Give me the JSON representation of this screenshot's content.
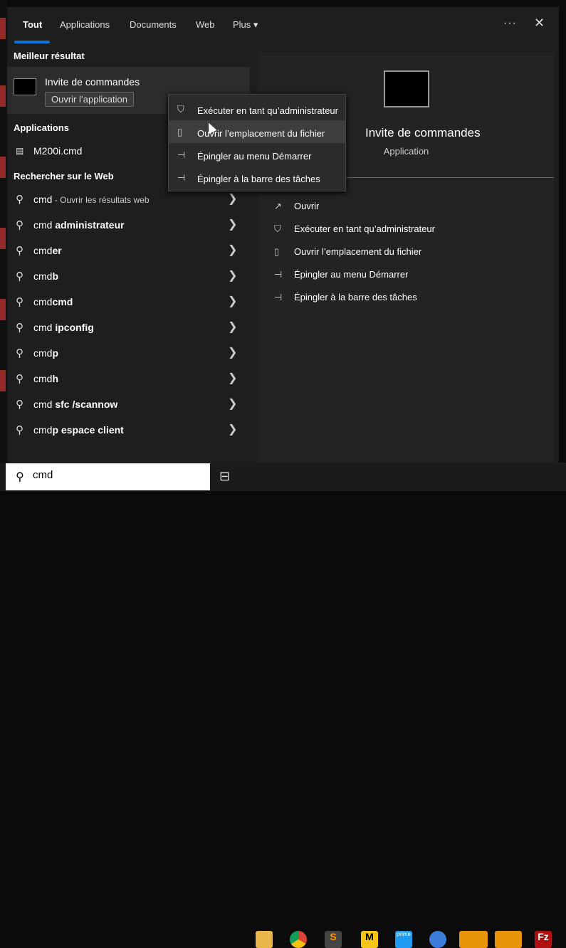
{
  "tabs": [
    {
      "label": "Tout"
    },
    {
      "label": "Applications"
    },
    {
      "label": "Documents"
    },
    {
      "label": "Web"
    },
    {
      "label": "Plus ▾"
    }
  ],
  "more_label": "···",
  "sections": {
    "best": "Meilleur résultat",
    "apps": "Applications",
    "web": "Rechercher sur le Web"
  },
  "best": {
    "title": "Invite de commandes",
    "open_label": "Ouvrir l’application"
  },
  "apps": [
    {
      "label": "M200i.cmd"
    }
  ],
  "web_results": [
    {
      "prefix": "cmd",
      "suffix": "",
      "note": " - Ouvrir les résultats web"
    },
    {
      "prefix": "cmd ",
      "suffix": "administrateur"
    },
    {
      "prefix": "cmd",
      "suffix": "er"
    },
    {
      "prefix": "cmd",
      "suffix": "b"
    },
    {
      "prefix": "cmd",
      "suffix": "cmd"
    },
    {
      "prefix": "cmd ",
      "suffix": "ipconfig"
    },
    {
      "prefix": "cmd",
      "suffix": "p"
    },
    {
      "prefix": "cmd",
      "suffix": "h"
    },
    {
      "prefix": "cmd ",
      "suffix": "sfc /scannow"
    },
    {
      "prefix": "cmd",
      "suffix": "p espace client"
    }
  ],
  "context_menu": [
    {
      "label": "Exécuter en tant qu’administrateur",
      "icon": "shield-icon"
    },
    {
      "label": "Ouvrir l’emplacement du fichier",
      "icon": "folder-icon",
      "hovered": true
    },
    {
      "label": "Épingler au menu Démarrer",
      "icon": "pin-icon"
    },
    {
      "label": "Épingler à la barre des tâches",
      "icon": "pin-icon"
    }
  ],
  "preview": {
    "title": "Invite de commandes",
    "subtitle": "Application",
    "actions": [
      {
        "label": "Ouvrir",
        "icon": "open-icon"
      },
      {
        "label": "Exécuter en tant qu’administrateur",
        "icon": "shield-icon"
      },
      {
        "label": "Ouvrir l’emplacement du fichier",
        "icon": "folder-icon"
      },
      {
        "label": "Épingler au menu Démarrer",
        "icon": "pin-icon"
      },
      {
        "label": "Épingler à la barre des tâches",
        "icon": "pin-icon"
      }
    ]
  },
  "search": {
    "value": "cmd"
  },
  "colors": {
    "accent": "#0a74d9"
  }
}
